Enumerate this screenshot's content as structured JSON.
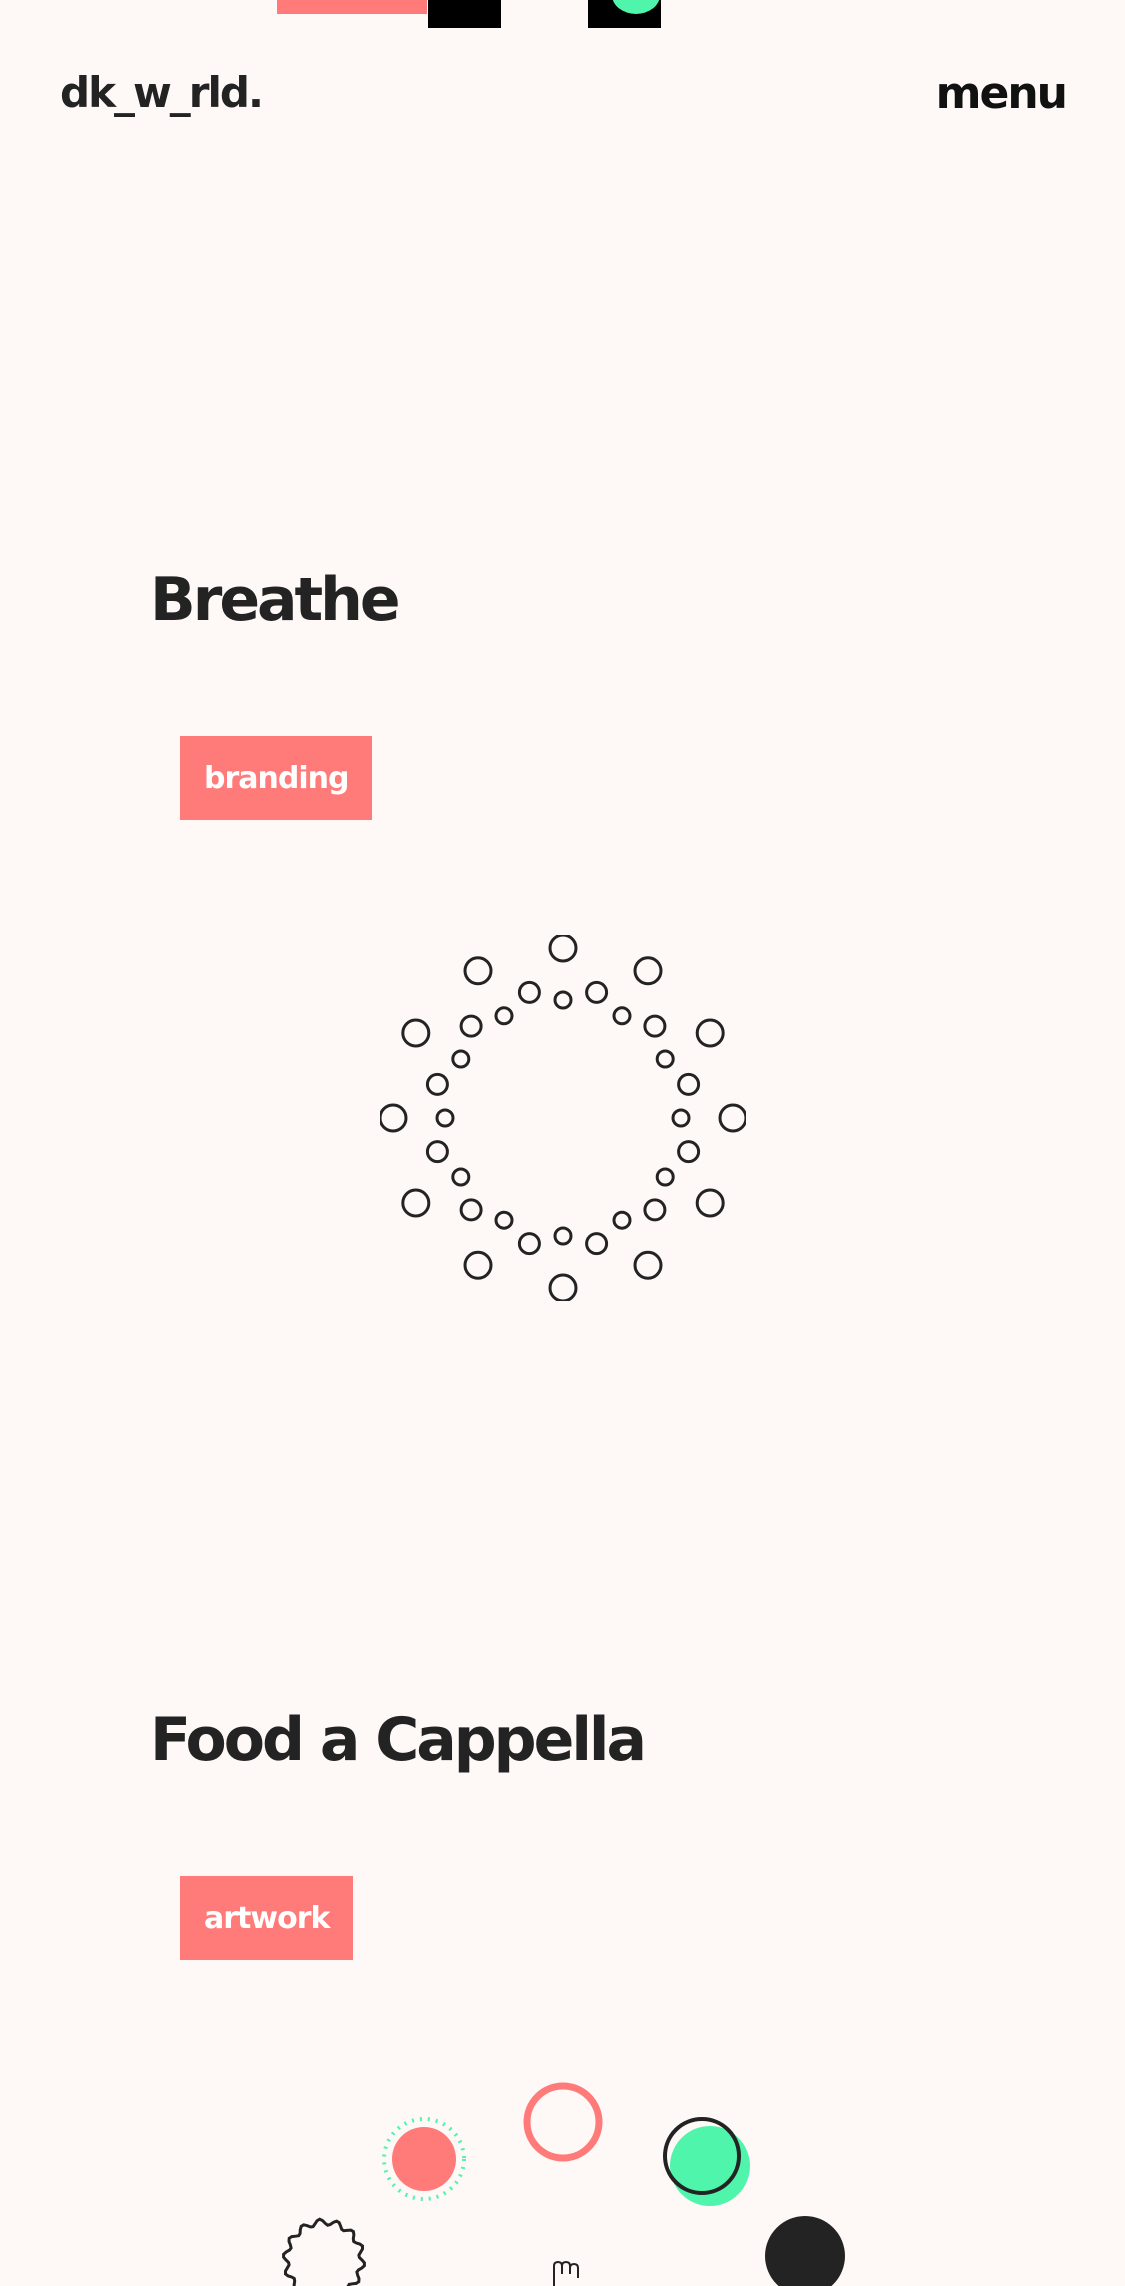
{
  "header": {
    "logo": "dk_w_rld.",
    "menu_label": "menu"
  },
  "projects": [
    {
      "title": "Breathe",
      "tag": "branding"
    },
    {
      "title": "Food a Cappella",
      "tag": "artwork"
    }
  ],
  "colors": {
    "background": "#fef8f7",
    "ink": "#232323",
    "coral": "#ff7b7a",
    "mint": "#4ff5ab"
  },
  "icons": {
    "ring_artwork": "dotted-circle-ring-icon",
    "shapes_artwork": "abstract-shapes-icon",
    "cursor": "hand-cursor-icon"
  }
}
